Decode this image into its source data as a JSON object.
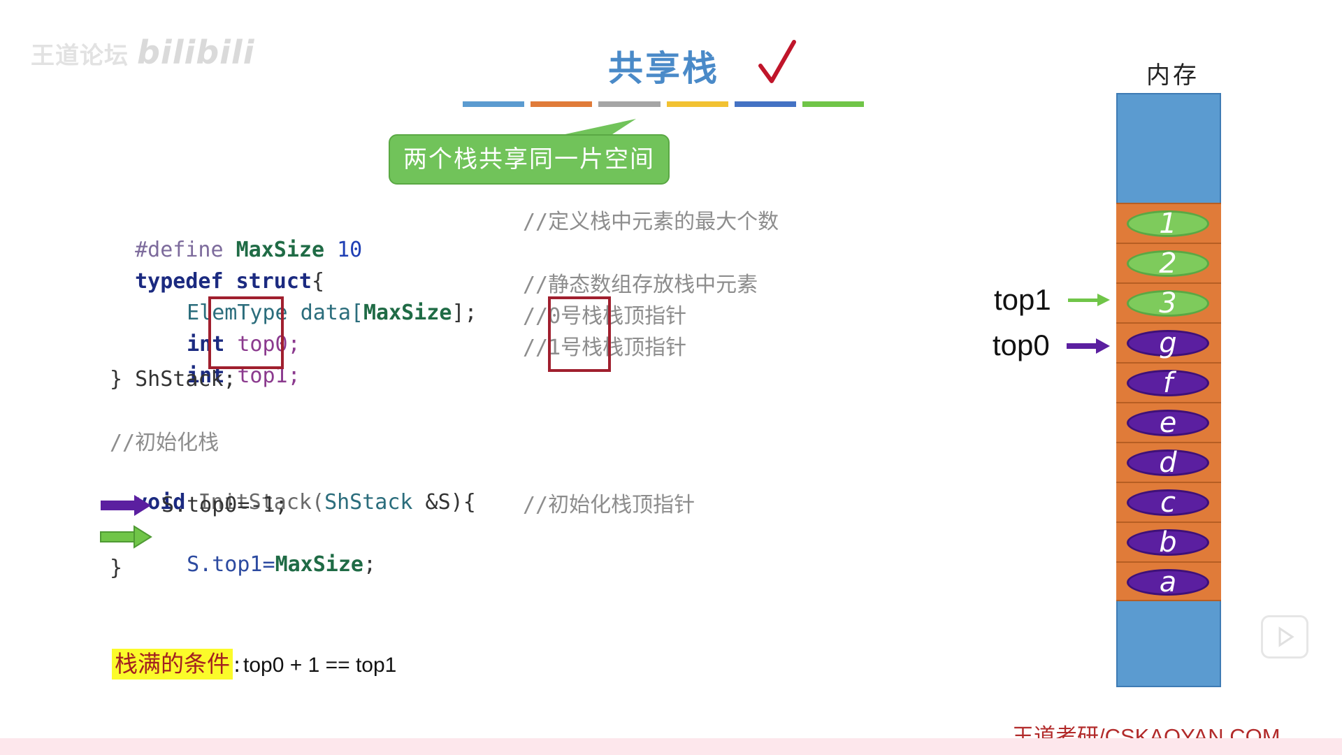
{
  "watermark": {
    "text": "王道论坛",
    "brand": "bilibili"
  },
  "slide": {
    "title": "共享栈",
    "callout": "两个栈共享同一片空间",
    "color_bars": [
      "#5b9bd0",
      "#e07b39",
      "#a5a5a5",
      "#f2c232",
      "#4472c4",
      "#70c548"
    ]
  },
  "code": {
    "line1": {
      "pre": "#define",
      "name": "MaxSize",
      "val": "10"
    },
    "line2": {
      "kw1": "typedef",
      "kw2": "struct",
      "brace": "{"
    },
    "line3": {
      "type": "ElemType",
      "rest": "data[",
      "size": "MaxSize",
      "end": "];"
    },
    "line4": {
      "kw": "int",
      "var": "top0;"
    },
    "line5": {
      "kw": "int",
      "var": "top1;"
    },
    "line6": {
      "text": "} ShStack;"
    },
    "line7": {
      "text": "//初始化栈"
    },
    "line8": {
      "kw": "void",
      "fn": "InitStack(",
      "type": "ShStack",
      "rest": " &S){"
    },
    "line9": {
      "text": "S.top0=-1;"
    },
    "line10": {
      "pre": "S.top1=",
      "val": "MaxSize",
      "end": ";"
    },
    "line11": {
      "text": "}"
    }
  },
  "comments": {
    "c1": "//定义栈中元素的最大个数",
    "c3": "//静态数组存放栈中元素",
    "c4": "//0号栈栈顶指针",
    "c5": "//1号栈栈顶指针",
    "c9": "//初始化栈顶指针"
  },
  "condition": {
    "label": "栈满的条件",
    "colon": ":",
    "expr": "top0 + 1 == top1"
  },
  "memory": {
    "title": "内存",
    "cells": [
      {
        "label": "1",
        "stack": "top1"
      },
      {
        "label": "2",
        "stack": "top1"
      },
      {
        "label": "3",
        "stack": "top1"
      },
      {
        "label": "g",
        "stack": "top0"
      },
      {
        "label": "f",
        "stack": "top0"
      },
      {
        "label": "e",
        "stack": "top0"
      },
      {
        "label": "d",
        "stack": "top0"
      },
      {
        "label": "c",
        "stack": "top0"
      },
      {
        "label": "b",
        "stack": "top0"
      },
      {
        "label": "a",
        "stack": "top0"
      }
    ],
    "pointers": {
      "top1": "top1",
      "top0": "top0"
    }
  },
  "colors": {
    "top0": "#5b1fa0",
    "top1": "#70c548",
    "highlight": "#a01f2e"
  },
  "footer": {
    "brand": "王道考研/CSKAOYAN.COM"
  }
}
